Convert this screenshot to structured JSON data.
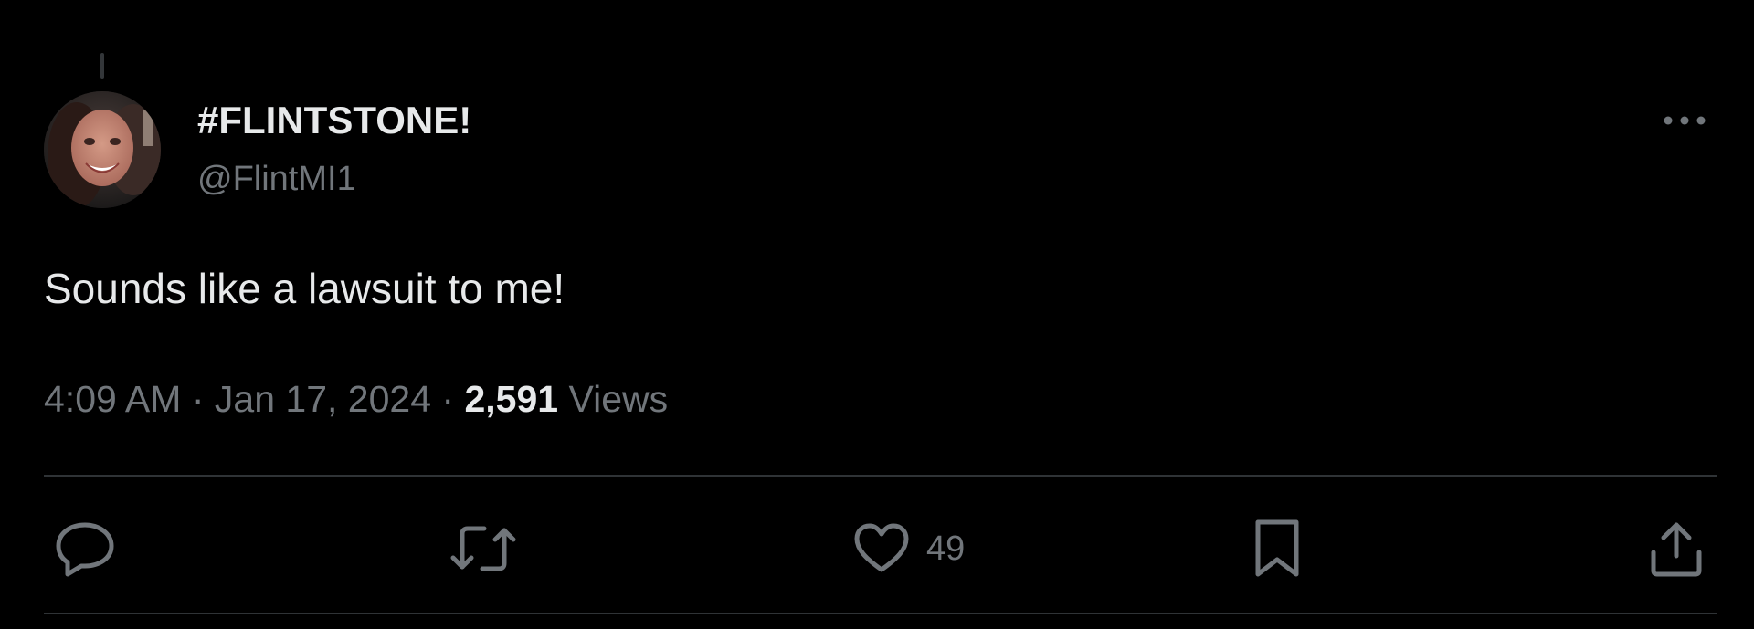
{
  "tweet": {
    "display_name": "#FLINTSTONE!",
    "handle": "@FlintMI1",
    "text": "Sounds like a lawsuit to me!",
    "time": "4:09 AM",
    "date": "Jan 17, 2024",
    "separator": "·",
    "views_count": "2,591",
    "views_label": "Views"
  },
  "actions": {
    "reply_icon": "reply-icon",
    "retweet_icon": "retweet-icon",
    "like_icon": "heart-icon",
    "like_count": "49",
    "bookmark_icon": "bookmark-icon",
    "share_icon": "share-icon"
  },
  "menu": {
    "more_icon": "more-horizontal-icon"
  },
  "colors": {
    "background": "#000000",
    "primary_text": "#e7e9ea",
    "secondary_text": "#71767b",
    "divider": "#2f3336"
  }
}
